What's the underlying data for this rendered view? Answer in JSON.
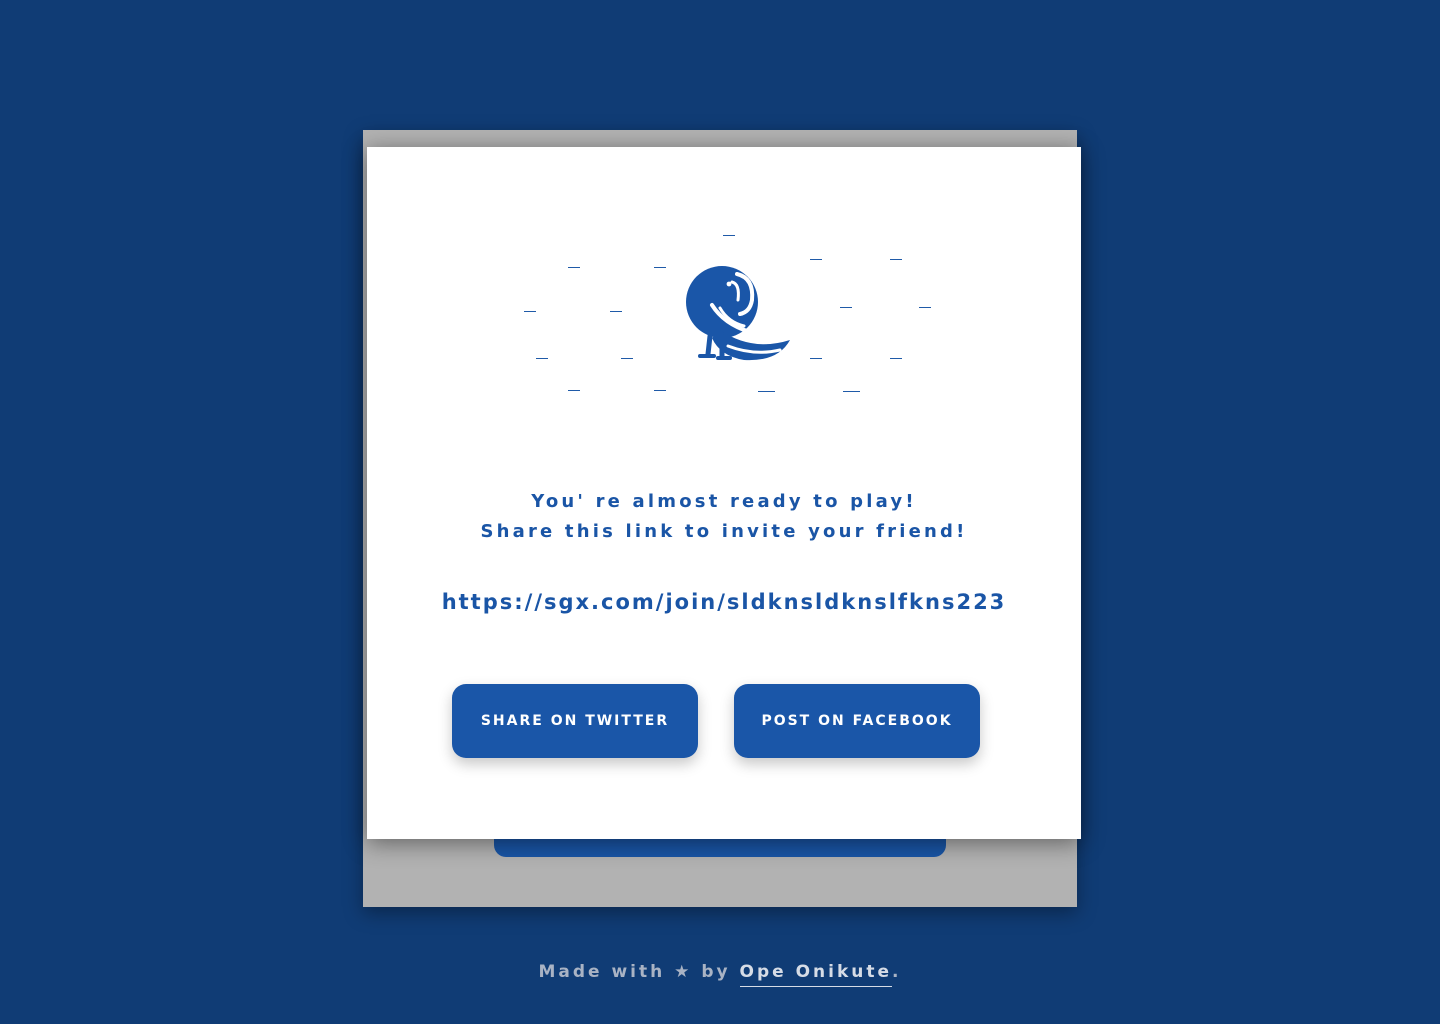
{
  "modal": {
    "message_line1": "You' re almost ready to play!",
    "message_line2": "Share this link to invite your friend!",
    "invite_link": "https://sgx.com/join/sldknsldknslfkns223",
    "twitter_button": "SHARE ON TWITTER",
    "facebook_button": "POST ON FACEBOOK",
    "icon": "parrot-icon"
  },
  "footer": {
    "prefix": "Made with",
    "symbol": "★",
    "by": "by",
    "author": "Ope Onikute",
    "suffix": "."
  },
  "colors": {
    "background": "#103c75",
    "accent": "#1a55a6",
    "backdrop_card": "#b2b2b2"
  }
}
